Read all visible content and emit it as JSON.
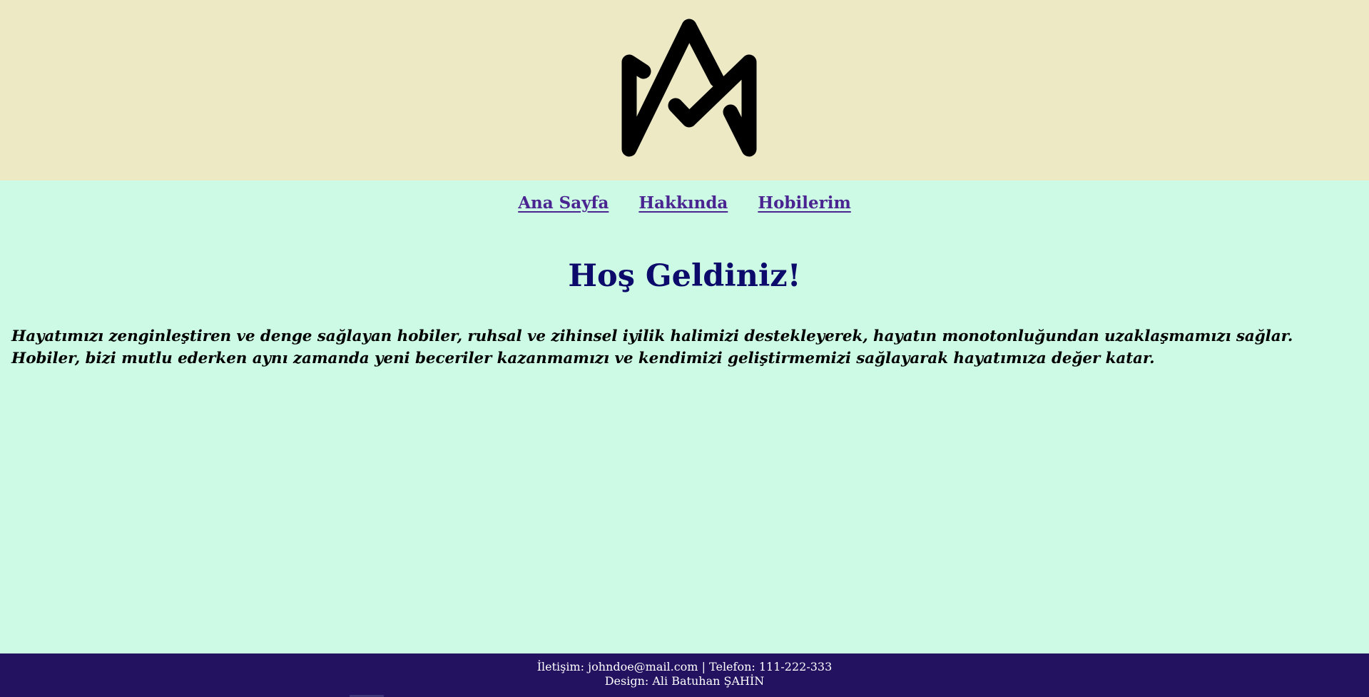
{
  "header": {
    "logo_icon": "am-monogram-logo-icon"
  },
  "nav": {
    "items": [
      {
        "label": "Ana Sayfa"
      },
      {
        "label": "Hakkında"
      },
      {
        "label": "Hobilerim"
      }
    ]
  },
  "main": {
    "title": "Hoş Geldiniz!",
    "intro": "Hayatımızı zenginleştiren ve denge sağlayan hobiler, ruhsal ve zihinsel iyilik halimizi destekleyerek, hayatın monotonluğundan uzaklaşmamızı sağlar. Hobiler, bizi mutlu ederken aynı zamanda yeni beceriler kazanmamızı ve kendimizi geliştirmemizi sağlayarak hayatımıza değer katar."
  },
  "footer": {
    "contact": "İletişim: johndoe@mail.com | Telefon: 111-222-333",
    "design": "Design: Ali Batuhan ŞAHİN"
  },
  "colors": {
    "header_bg": "#ede9c5",
    "page_bg": "#ccfae4",
    "nav_link": "#4a2592",
    "title": "#0c0a6a",
    "footer_bg": "#231260",
    "footer_text": "#ffffff"
  }
}
